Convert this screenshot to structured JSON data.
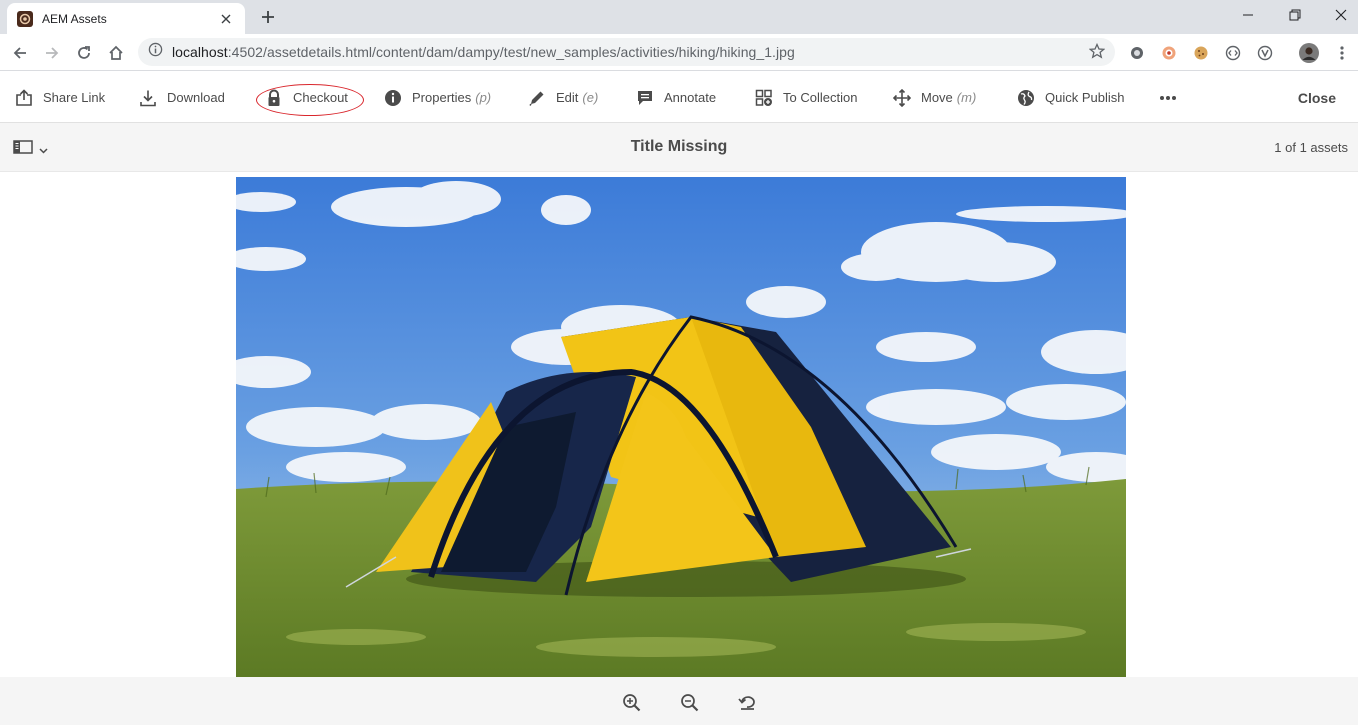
{
  "browser": {
    "tab_title": "AEM Assets",
    "url_host": "localhost",
    "url_path": ":4502/assetdetails.html/content/dam/dampy/test/new_samples/activities/hiking/hiking_1.jpg"
  },
  "actionbar": {
    "items": [
      {
        "label": "Share Link",
        "icon": "share-icon",
        "shortcut": ""
      },
      {
        "label": "Download",
        "icon": "download-icon",
        "shortcut": ""
      },
      {
        "label": "Checkout",
        "icon": "lock-icon",
        "shortcut": ""
      },
      {
        "label": "Properties",
        "icon": "info-icon",
        "shortcut": "(p)"
      },
      {
        "label": "Edit",
        "icon": "pencil-icon",
        "shortcut": "(e)"
      },
      {
        "label": "Annotate",
        "icon": "comment-icon",
        "shortcut": ""
      },
      {
        "label": "To Collection",
        "icon": "add-to-collection-icon",
        "shortcut": ""
      },
      {
        "label": "Move",
        "icon": "move-icon",
        "shortcut": "(m)"
      },
      {
        "label": "Quick Publish",
        "icon": "globe-icon",
        "shortcut": ""
      }
    ],
    "more_icon": "more-icon",
    "close_label": "Close",
    "annotation_color": "#d9262c"
  },
  "titlebar": {
    "title": "Title Missing",
    "count": "1 of 1 assets"
  },
  "asset": {
    "name": "hiking_1.jpg",
    "depiction": "yellow-and-navy dome tent on a grassy hill under a blue sky with clouds"
  },
  "zoombar": {
    "icons": [
      "zoom-in-icon",
      "zoom-out-icon",
      "reset-zoom-icon"
    ]
  },
  "colors": {
    "chrome_bg": "#dee1e6",
    "text": "#4b4b4b",
    "sky": "#3d7fd6",
    "tent_yellow": "#f2c416",
    "tent_navy": "#14213d",
    "grass": "#6b8b2f"
  }
}
